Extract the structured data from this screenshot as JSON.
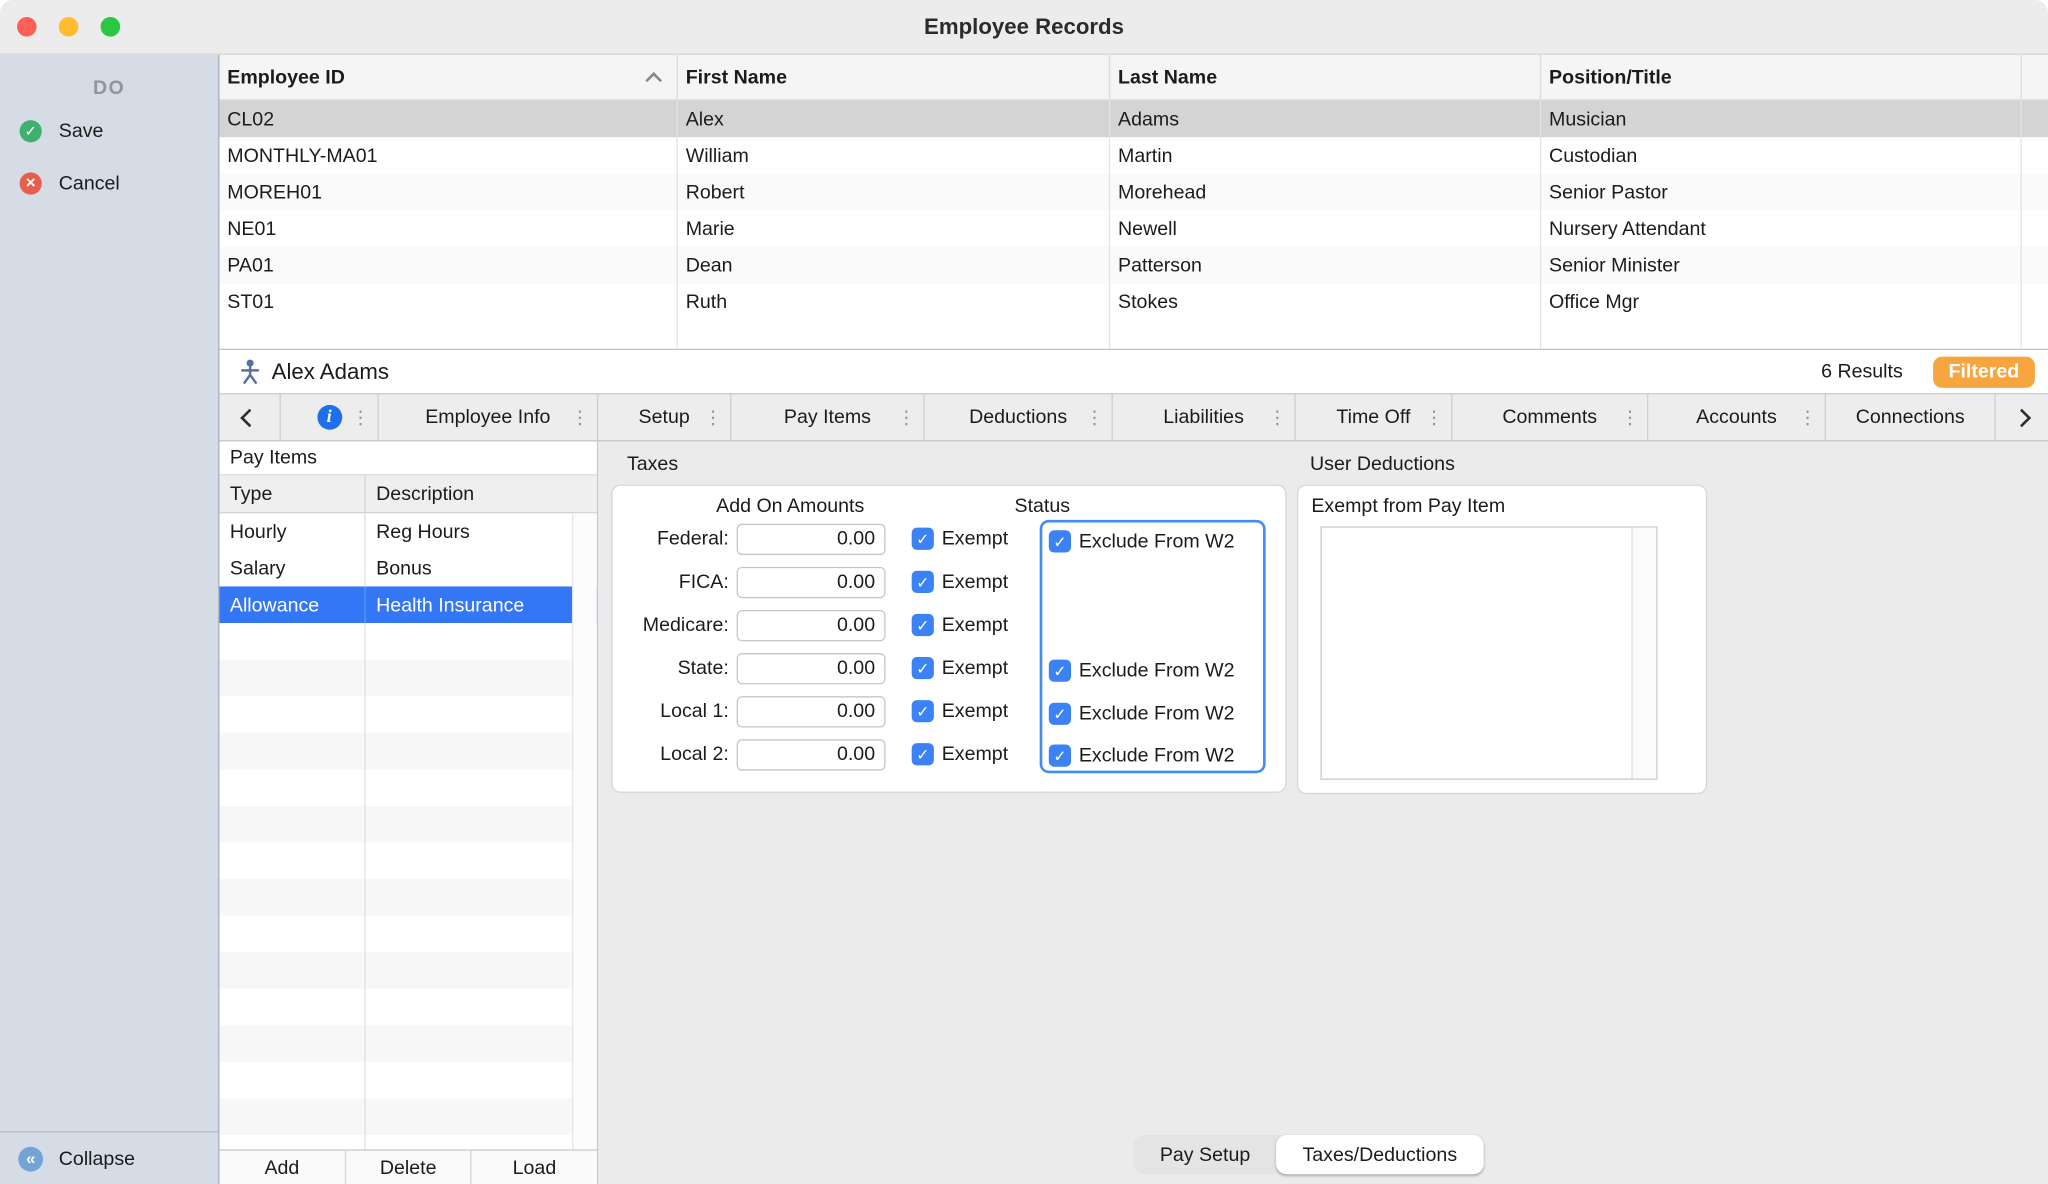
{
  "window": {
    "title": "Employee Records"
  },
  "sidebar": {
    "header": "DO",
    "save_label": "Save",
    "cancel_label": "Cancel",
    "collapse_label": "Collapse"
  },
  "employee_table": {
    "columns": [
      "Employee ID",
      "First Name",
      "Last Name",
      "Position/Title"
    ],
    "sorted_column": "Employee ID",
    "sort_direction": "ascending",
    "rows": [
      {
        "employee_id": "CL02",
        "first_name": "Alex",
        "last_name": "Adams",
        "position": "Musician",
        "selected": true
      },
      {
        "employee_id": "MONTHLY-MA01",
        "first_name": "William",
        "last_name": "Martin",
        "position": "Custodian",
        "selected": false
      },
      {
        "employee_id": "MOREH01",
        "first_name": "Robert",
        "last_name": "Morehead",
        "position": "Senior Pastor",
        "selected": false
      },
      {
        "employee_id": "NE01",
        "first_name": "Marie",
        "last_name": "Newell",
        "position": "Nursery Attendant",
        "selected": false
      },
      {
        "employee_id": "PA01",
        "first_name": "Dean",
        "last_name": "Patterson",
        "position": "Senior Minister",
        "selected": false
      },
      {
        "employee_id": "ST01",
        "first_name": "Ruth",
        "last_name": "Stokes",
        "position": "Office Mgr",
        "selected": false
      }
    ]
  },
  "record_bar": {
    "name": "Alex Adams",
    "results": "6 Results",
    "filtered_badge": "Filtered"
  },
  "tabs": {
    "items": [
      "Employee Info",
      "Setup",
      "Pay Items",
      "Deductions",
      "Liabilities",
      "Time Off",
      "Comments",
      "Accounts",
      "Connections"
    ],
    "active": "Pay Items"
  },
  "pay_items_panel": {
    "title": "Pay Items",
    "columns": [
      "Type",
      "Description"
    ],
    "rows": [
      {
        "type": "Hourly",
        "description": "Reg Hours",
        "selected": false
      },
      {
        "type": "Salary",
        "description": "Bonus",
        "selected": false
      },
      {
        "type": "Allowance",
        "description": "Health Insurance",
        "selected": true
      }
    ],
    "buttons": {
      "add": "Add",
      "delete": "Delete",
      "load": "Load"
    }
  },
  "taxes": {
    "title": "Taxes",
    "add_on_header": "Add On Amounts",
    "status_header": "Status",
    "exempt_label": "Exempt",
    "exclude_label": "Exclude From W2",
    "rows": [
      {
        "label": "Federal:",
        "amount": "0.00",
        "exempt": true,
        "exclude_from_w2": true
      },
      {
        "label": "FICA:",
        "amount": "0.00",
        "exempt": true
      },
      {
        "label": "Medicare:",
        "amount": "0.00",
        "exempt": true
      },
      {
        "label": "State:",
        "amount": "0.00",
        "exempt": true,
        "exclude_from_w2": true
      },
      {
        "label": "Local 1:",
        "amount": "0.00",
        "exempt": true,
        "exclude_from_w2": true
      },
      {
        "label": "Local 2:",
        "amount": "0.00",
        "exempt": true,
        "exclude_from_w2": true
      }
    ]
  },
  "user_deductions": {
    "title": "User Deductions",
    "exempt_from_label": "Exempt  from Pay Item",
    "items": []
  },
  "bottom_tabs": {
    "items": [
      "Pay Setup",
      "Taxes/Deductions"
    ],
    "active": "Taxes/Deductions"
  },
  "icons": {
    "save": "green-check-circle",
    "cancel": "red-x-circle",
    "collapse": "blue-double-chevron-left-circle",
    "record": "person-icon",
    "info_tab": "blue-info-circle",
    "sort": "chevron-up-icon",
    "tab_menu": "vertical-ellipsis-icon",
    "checkbox": "blue-checkbox-checked"
  },
  "colors": {
    "accent_blue": "#3477F6",
    "checkbox_blue": "#3B82F7",
    "focus_ring_blue": "#418CF9",
    "filtered_badge_orange": "#F7A63F",
    "sidebar_bg": "#D5DCE6",
    "selected_row_gray": "#D4D4D4"
  }
}
